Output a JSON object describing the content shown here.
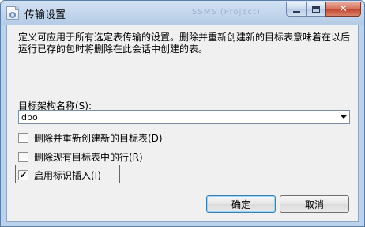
{
  "window": {
    "title": "传输设置",
    "ghost_title": "SSMS (Project)"
  },
  "description": "定义可应用于所有选定表传输的设置。删除并重新创建新的目标表意味着在以后运行已存的包时将删除在此会话中创建的表。",
  "schema": {
    "label": "目标架构名称(S):",
    "value": "dbo"
  },
  "options": [
    {
      "label": "删除并重新创建新的目标表(D)",
      "checked": false
    },
    {
      "label": "删除现有目标表中的行(R)",
      "checked": false
    },
    {
      "label": "启用标识插入(I)",
      "checked": true
    }
  ],
  "buttons": {
    "ok": "确定",
    "cancel": "取消"
  },
  "icons": {
    "app": "settings-document-icon",
    "combo_arrow": "chevron-down-icon",
    "check": "checkmark-icon"
  },
  "colors": {
    "highlight": "#e0303a",
    "close_button": "#c0432a"
  }
}
